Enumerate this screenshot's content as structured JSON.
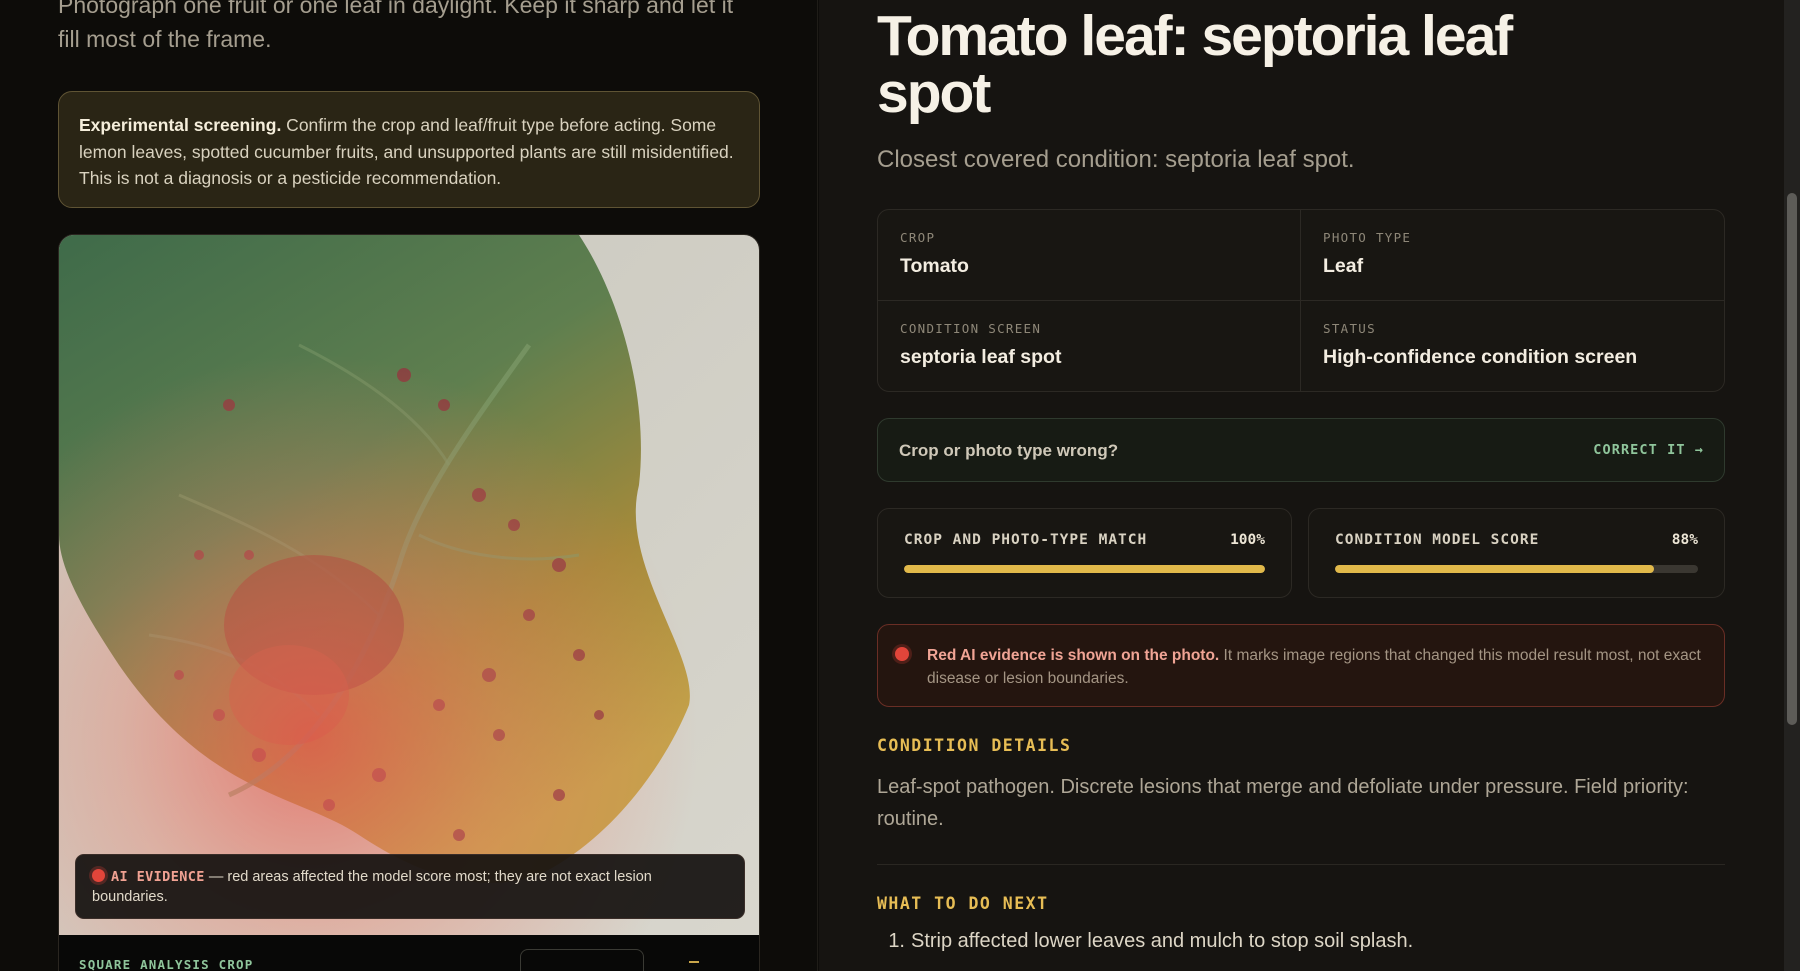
{
  "left": {
    "intro": "Photograph one fruit or one leaf in daylight. Keep it sharp and let it fill most of the frame.",
    "notice": {
      "bold": "Experimental screening.",
      "text": " Confirm the crop and leaf/fruit type before acting. Some lemon leaves, spotted cucumber fruits, and unsupported plants are still misidentified. This is not a diagnosis or a pesticide recommendation."
    },
    "evidence_chip": {
      "label": "AI EVIDENCE",
      "text": " — red areas affected the model score most; they are not exact lesion boundaries."
    },
    "crop_label": "SQUARE ANALYSIS CROP"
  },
  "result": {
    "title": "Tomato leaf: septoria leaf spot",
    "subtitle": "Closest covered condition: septoria leaf spot.",
    "facts": [
      {
        "key": "CROP",
        "value": "Tomato"
      },
      {
        "key": "PHOTO TYPE",
        "value": "Leaf"
      },
      {
        "key": "CONDITION SCREEN",
        "value": "septoria leaf spot"
      },
      {
        "key": "STATUS",
        "value": "High-confidence condition screen"
      }
    ],
    "correction": {
      "question": "Crop or photo type wrong?",
      "button": "CORRECT IT →"
    },
    "meters": [
      {
        "label": "CROP AND PHOTO-TYPE MATCH",
        "percent_text": "100%",
        "value": 100
      },
      {
        "label": "CONDITION MODEL SCORE",
        "percent_text": "88%",
        "value": 88
      }
    ],
    "alert": {
      "bold": "Red AI evidence is shown on the photo.",
      "text": " It marks image regions that changed this model result most, not exact disease or lesion boundaries."
    },
    "details_heading": "CONDITION DETAILS",
    "details_text": "Leaf-spot pathogen. Discrete lesions that merge and defoliate under pressure. Field priority: routine.",
    "next_heading": "WHAT TO DO NEXT",
    "next_steps": [
      {
        "num": "1.",
        "text": "Strip affected lower leaves and mulch to stop soil splash."
      }
    ]
  },
  "colors": {
    "accent_yellow": "#e1b94a",
    "accent_green": "#8fc59b",
    "evidence_red": "#e2453a"
  }
}
